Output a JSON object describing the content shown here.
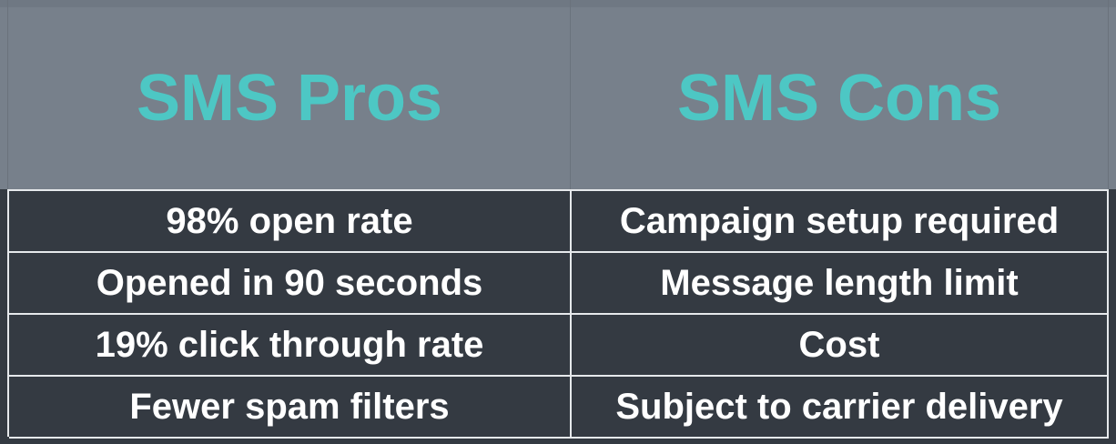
{
  "header": {
    "pros_title": "SMS Pros",
    "cons_title": "SMS Cons"
  },
  "rows": [
    {
      "pro": "98% open rate",
      "con": "Campaign setup required"
    },
    {
      "pro": "Opened in 90 seconds",
      "con": "Message length limit"
    },
    {
      "pro": "19% click through rate",
      "con": "Cost"
    },
    {
      "pro": "Fewer spam filters",
      "con": "Subject to carrier delivery"
    }
  ],
  "colors": {
    "header_background": "#77808b",
    "title_text": "#4dc7c4",
    "table_background": "#343a42",
    "cell_text": "#ffffff",
    "grid_lines": "#e6e9ec"
  }
}
